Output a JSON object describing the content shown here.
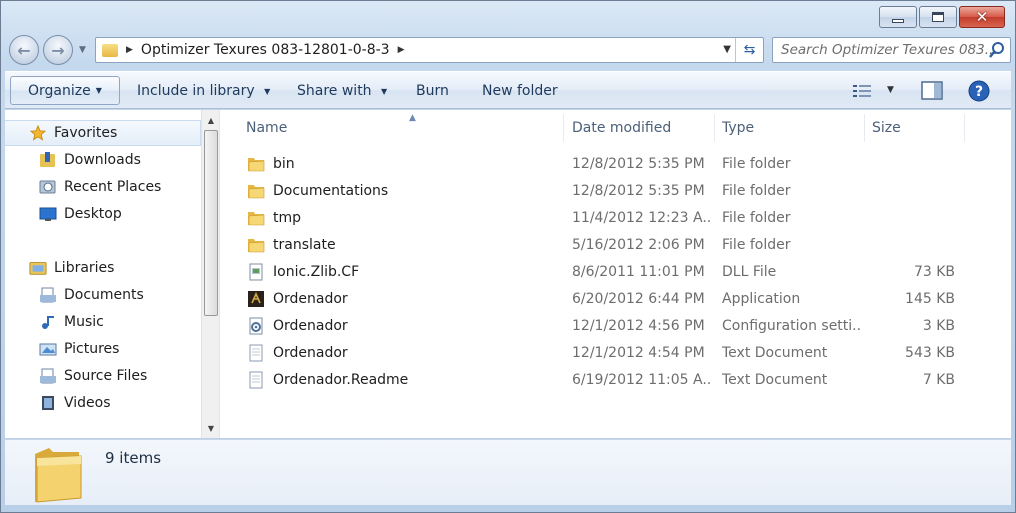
{
  "window": {
    "caption_buttons": {
      "minimize": "minimize-icon",
      "maximize": "maximize-icon",
      "close": "close-icon"
    }
  },
  "navigation": {
    "back_icon": "back-arrow-icon",
    "forward_icon": "forward-arrow-icon",
    "address": {
      "crumb": "Optimizer Texures 083-12801-0-8-3"
    },
    "search": {
      "placeholder": "Search Optimizer Texures 083..."
    }
  },
  "toolbar": {
    "organize": "Organize",
    "include_in_library": "Include in library",
    "share_with": "Share with",
    "burn": "Burn",
    "new_folder": "New folder"
  },
  "nav_pane": {
    "favorites": {
      "label": "Favorites",
      "items": [
        "Downloads",
        "Recent Places",
        "Desktop"
      ]
    },
    "libraries": {
      "label": "Libraries",
      "items": [
        "Documents",
        "Music",
        "Pictures",
        "Source Files",
        "Videos"
      ]
    }
  },
  "file_list": {
    "columns": [
      "Name",
      "Date modified",
      "Type",
      "Size"
    ],
    "rows": [
      {
        "name": "bin",
        "date": "12/8/2012 5:35 PM",
        "type": "File folder",
        "size": "",
        "icon": "folder-icon"
      },
      {
        "name": "Documentations",
        "date": "12/8/2012 5:35 PM",
        "type": "File folder",
        "size": "",
        "icon": "folder-icon"
      },
      {
        "name": "tmp",
        "date": "11/4/2012 12:23 A...",
        "type": "File folder",
        "size": "",
        "icon": "folder-icon"
      },
      {
        "name": "translate",
        "date": "5/16/2012 2:06 PM",
        "type": "File folder",
        "size": "",
        "icon": "folder-icon"
      },
      {
        "name": "Ionic.Zlib.CF",
        "date": "8/6/2011 11:01 PM",
        "type": "DLL File",
        "size": "73 KB",
        "icon": "dll-file-icon"
      },
      {
        "name": "Ordenador",
        "date": "6/20/2012 6:44 PM",
        "type": "Application",
        "size": "145 KB",
        "icon": "application-icon"
      },
      {
        "name": "Ordenador",
        "date": "12/1/2012 4:56 PM",
        "type": "Configuration setti...",
        "size": "3 KB",
        "icon": "config-file-icon"
      },
      {
        "name": "Ordenador",
        "date": "12/1/2012 4:54 PM",
        "type": "Text Document",
        "size": "543 KB",
        "icon": "text-file-icon"
      },
      {
        "name": "Ordenador.Readme",
        "date": "6/19/2012 11:05 A...",
        "type": "Text Document",
        "size": "7 KB",
        "icon": "text-file-icon"
      }
    ]
  },
  "details": {
    "item_count": "9 items"
  },
  "colors": {
    "accent": "#1e395b",
    "selection": "#e4eef9",
    "folder": "#e7b743"
  }
}
